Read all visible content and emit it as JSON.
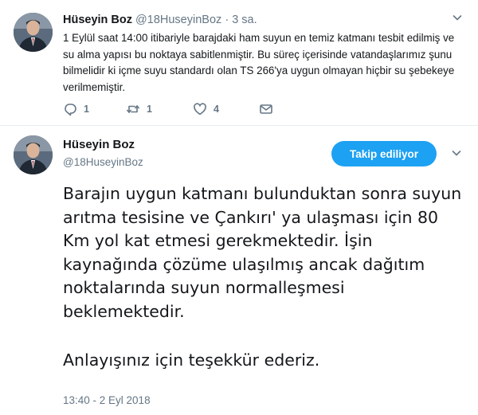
{
  "parent_tweet": {
    "name": "Hüseyin Boz",
    "handle": "@18HuseyinBoz",
    "separator": "·",
    "time_ago": "3 sa.",
    "text": "1 Eylül saat 14:00 itibariyle barajdaki ham suyun en temiz katmanı tesbit edilmiş ve su alma yapısı bu noktaya sabitlenmiştir. Bu süreç içerisinde vatandaşlarımız şunu bilmelidir ki içme suyu standardı olan TS 266'ya uygun olmayan hiçbir su şebekeye verilmemiştir.",
    "reply_count": "1",
    "retweet_count": "1",
    "like_count": "4"
  },
  "main_tweet": {
    "name": "Hüseyin Boz",
    "handle": "@18HuseyinBoz",
    "follow_button": "Takip ediliyor",
    "paragraph1": "Barajın uygun katmanı bulunduktan sonra suyun arıtma tesisine ve Çankırı' ya ulaşması için 80 Km yol kat etmesi gerekmektedir. İşin kaynağında çözüme ulaşılmış ancak dağıtım noktalarında suyun normalleşmesi beklemektedir.",
    "paragraph2": "Anlayışınız için teşekkür ederiz.",
    "timestamp": "13:40 - 2 Eyl 2018"
  },
  "colors": {
    "accent": "#1da1f2",
    "text_primary": "#14171a",
    "text_secondary": "#657786",
    "divider": "#e6ecf0"
  },
  "icons": {
    "reply": "reply-icon",
    "retweet": "retweet-icon",
    "like": "heart-icon",
    "dm": "envelope-icon",
    "more": "chevron-down-icon"
  }
}
